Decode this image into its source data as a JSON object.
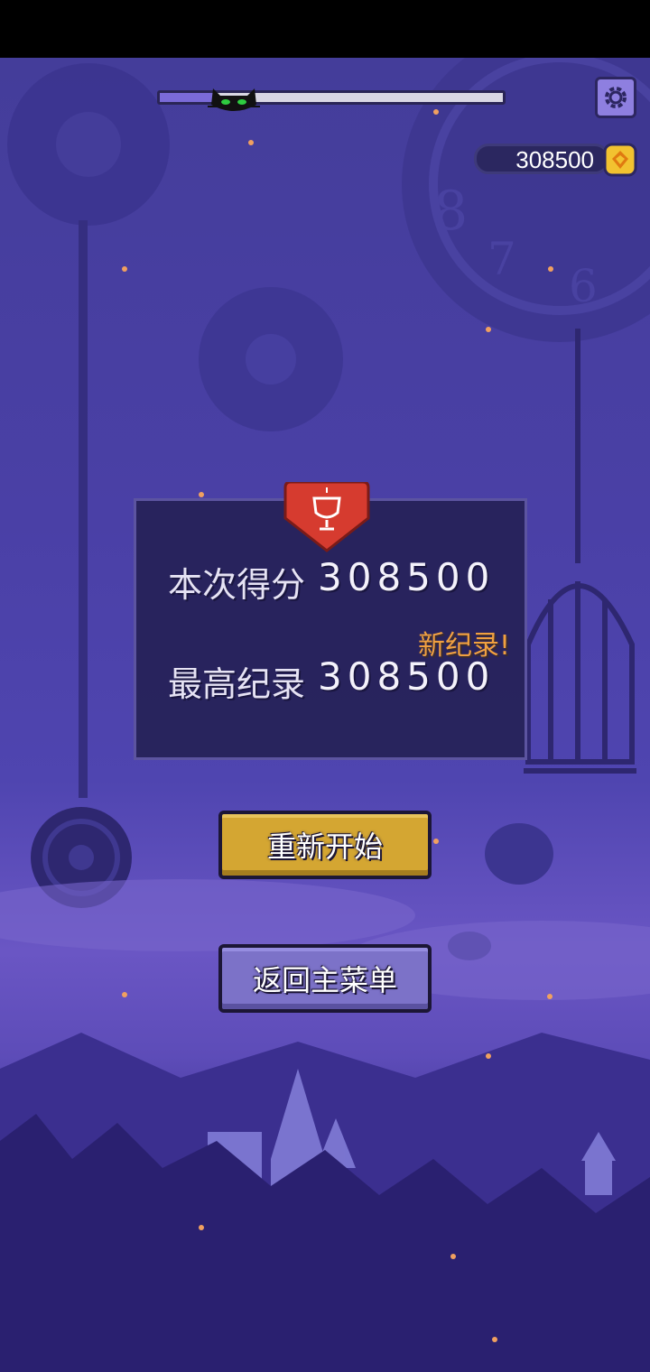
{
  "hud": {
    "level_progress": 0.16,
    "coins": "308500",
    "icons": {
      "settings": "gear-icon",
      "coin": "coin-icon",
      "progress_marker": "cat-icon"
    }
  },
  "result": {
    "trophy_icon": "trophy-icon",
    "score_label": "本次得分",
    "score_value": "308500",
    "new_record_label": "新纪录!",
    "best_label": "最高纪录",
    "best_value": "308500"
  },
  "buttons": {
    "restart_label": "重新开始",
    "main_menu_label": "返回主菜单"
  },
  "colors": {
    "background": "#4a40a6",
    "restart": "#d4a632",
    "menu": "#7c72c8",
    "new_record": "#f0a040",
    "ribbon": "#d63b2f"
  }
}
